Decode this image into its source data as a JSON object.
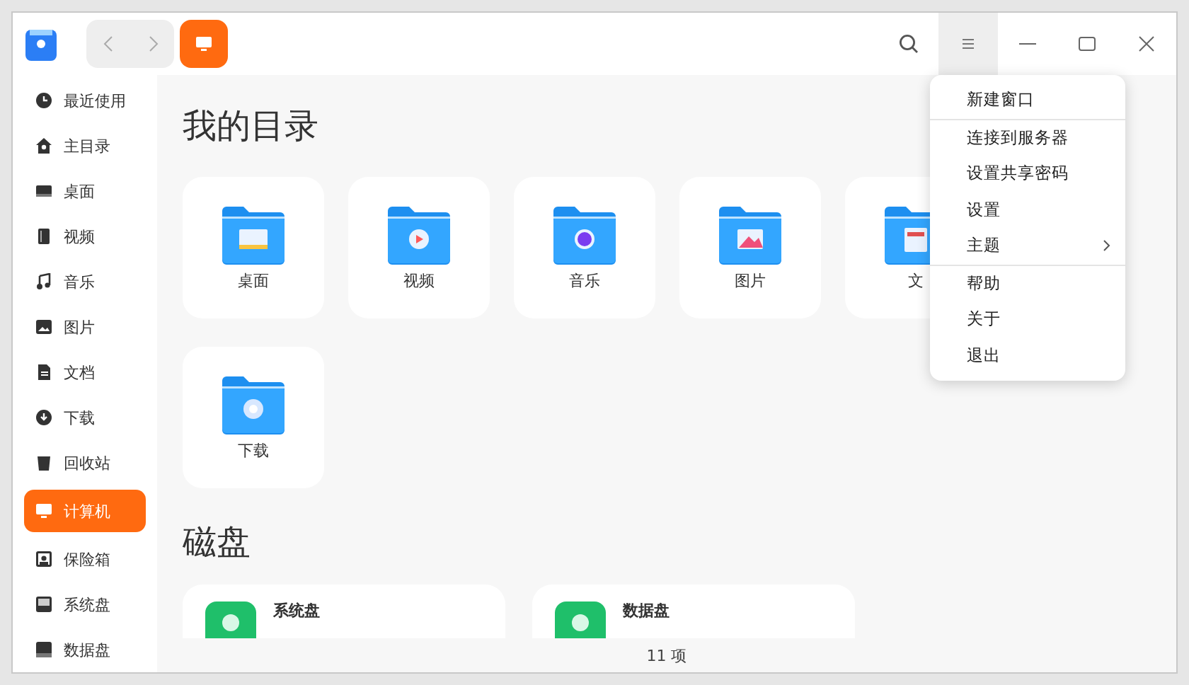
{
  "titlebar": {
    "menu_open": true
  },
  "sidebar": {
    "items": [
      {
        "label": "最近使用",
        "selected": false
      },
      {
        "label": "主目录",
        "selected": false
      },
      {
        "label": "桌面",
        "selected": false
      },
      {
        "label": "视频",
        "selected": false
      },
      {
        "label": "音乐",
        "selected": false
      },
      {
        "label": "图片",
        "selected": false
      },
      {
        "label": "文档",
        "selected": false
      },
      {
        "label": "下载",
        "selected": false
      },
      {
        "label": "回收站",
        "selected": false
      },
      {
        "label": "计算机",
        "selected": true
      },
      {
        "label": "保险箱",
        "selected": false
      },
      {
        "label": "系统盘",
        "selected": false
      },
      {
        "label": "数据盘",
        "selected": false
      }
    ]
  },
  "sections": [
    {
      "title": "我的目录",
      "folders": [
        {
          "label": "桌面"
        },
        {
          "label": "视频"
        },
        {
          "label": "音乐"
        },
        {
          "label": "图片"
        },
        {
          "label": "文"
        },
        {
          "label": "下载"
        }
      ]
    },
    {
      "title": "磁盘",
      "disks": [
        {
          "label": "系统盘"
        },
        {
          "label": "数据盘"
        }
      ]
    }
  ],
  "status_bar": {
    "text": "11 项"
  },
  "menu": {
    "items": [
      {
        "label": "新建窗口",
        "submenu": false,
        "separator_after": true
      },
      {
        "label": "连接到服务器",
        "submenu": false,
        "separator_after": false
      },
      {
        "label": "设置共享密码",
        "submenu": false,
        "separator_after": false
      },
      {
        "label": "设置",
        "submenu": false,
        "separator_after": false
      },
      {
        "label": "主题",
        "submenu": true,
        "separator_after": true
      },
      {
        "label": "帮助",
        "submenu": false,
        "separator_after": false
      },
      {
        "label": "关于",
        "submenu": false,
        "separator_after": false
      },
      {
        "label": "退出",
        "submenu": false,
        "separator_after": false
      }
    ]
  }
}
